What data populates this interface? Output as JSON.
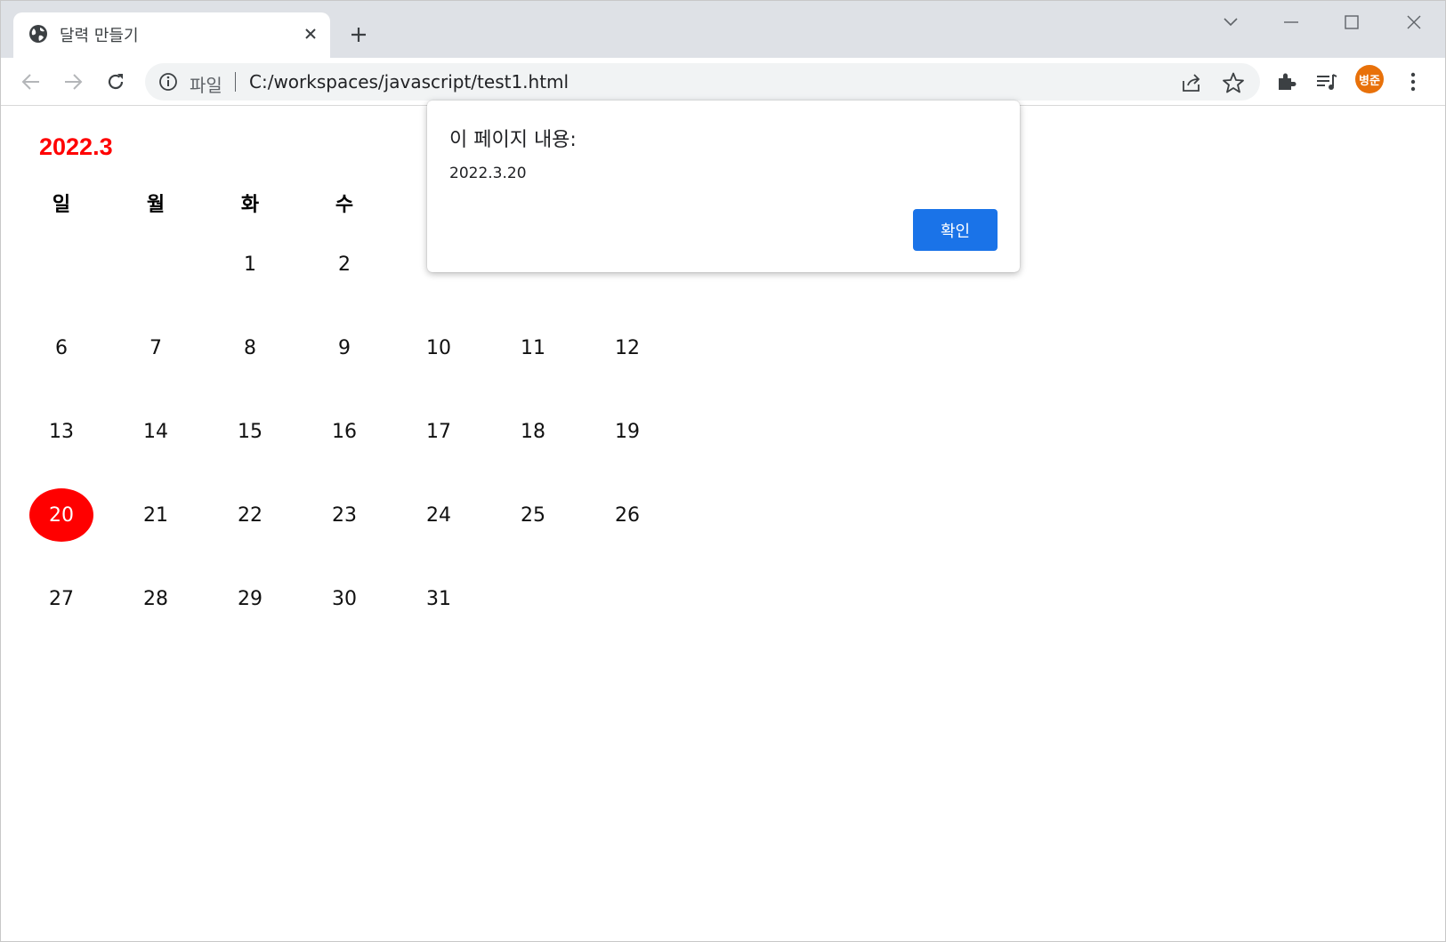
{
  "browser": {
    "tab": {
      "title": "달력 만들기",
      "icon": "globe-icon"
    },
    "omnibox": {
      "scheme_label": "파일",
      "url": "C:/workspaces/javascript/test1.html"
    },
    "profile": {
      "avatar_text": "병준",
      "color": "#e8710a"
    }
  },
  "calendar": {
    "title": "2022.3",
    "title_color": "#ff0000",
    "today_color": "#ff0000",
    "weekdays": [
      "일",
      "월",
      "화",
      "수",
      "",
      "",
      ""
    ],
    "weeks": [
      [
        "",
        "",
        "1",
        "2",
        "",
        "",
        ""
      ],
      [
        "6",
        "7",
        "8",
        "9",
        "10",
        "11",
        "12"
      ],
      [
        "13",
        "14",
        "15",
        "16",
        "17",
        "18",
        "19"
      ],
      [
        "20",
        "21",
        "22",
        "23",
        "24",
        "25",
        "26"
      ],
      [
        "27",
        "28",
        "29",
        "30",
        "31",
        "",
        ""
      ]
    ],
    "today": "20"
  },
  "dialog": {
    "title": "이 페이지 내용:",
    "message": "2022.3.20",
    "ok_label": "확인",
    "ok_color": "#1a73e8"
  }
}
